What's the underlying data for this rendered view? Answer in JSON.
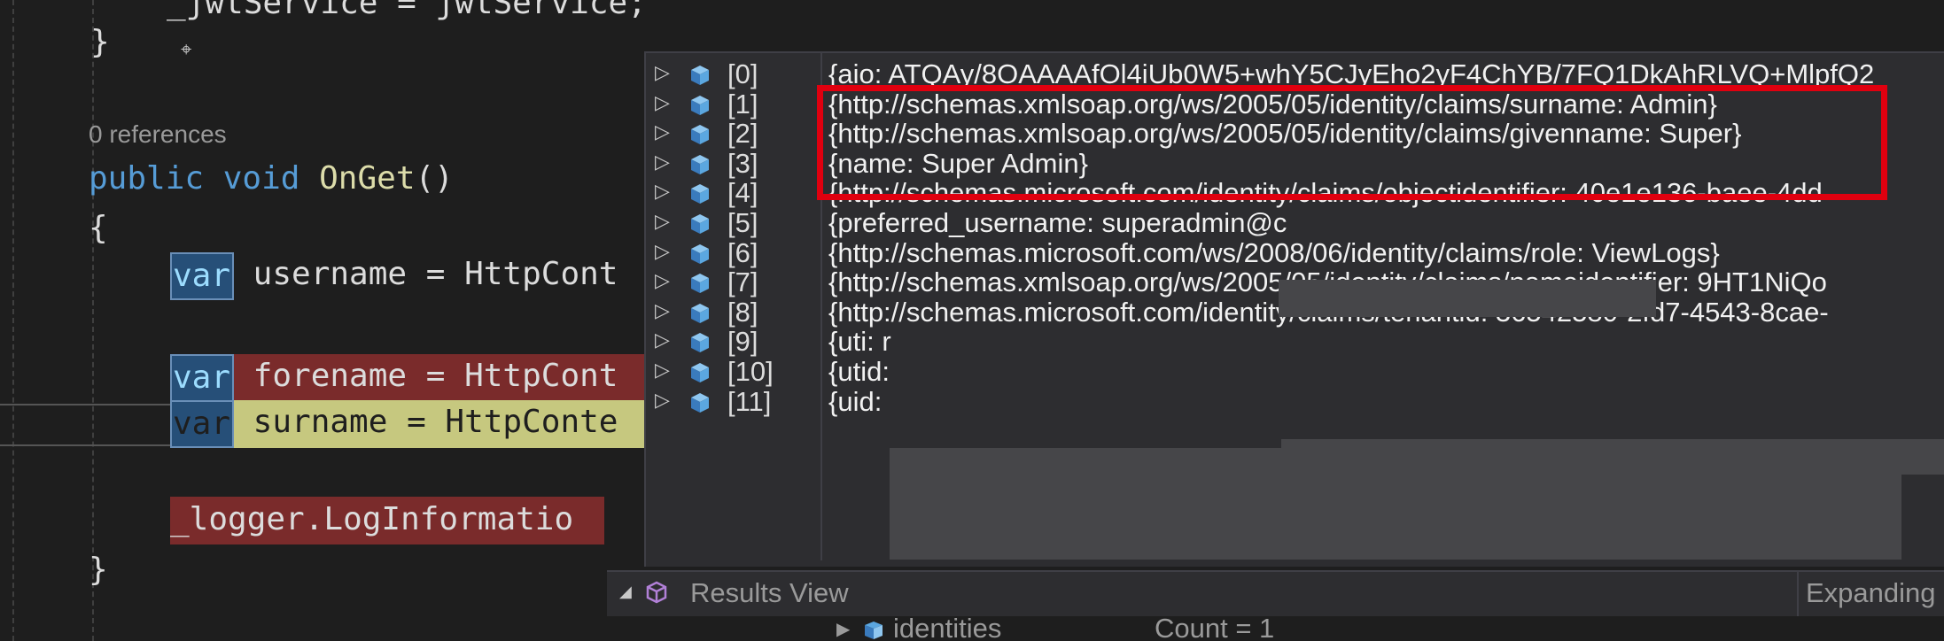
{
  "editor": {
    "line_partial_top": "_jwtService = jwtService;",
    "closing_brace_1": "}",
    "references": "0 references",
    "method_sig": {
      "public": "public",
      "void": "void",
      "name": "OnGet",
      "parens": "()"
    },
    "open_brace": "{",
    "line_username": {
      "var": "var",
      "rest": " username = HttpCont"
    },
    "line_forename": {
      "var": "var",
      "rest": " forename = HttpCont"
    },
    "line_surname": {
      "var": "var",
      "rest": " surname = HttpConte"
    },
    "line_logger": "_logger.LogInformatio",
    "closing_brace_2": "}"
  },
  "datatip": {
    "rows": [
      {
        "index": "[0]",
        "value": "{aio: ATQAy/8OAAAAfOl4iUb0W5+whY5CJyEho2yF4ChYB/7FQ1DkAhRLVQ+MlpfQ2"
      },
      {
        "index": "[1]",
        "value": "{http://schemas.xmlsoap.org/ws/2005/05/identity/claims/surname: Admin}"
      },
      {
        "index": "[2]",
        "value": "{http://schemas.xmlsoap.org/ws/2005/05/identity/claims/givenname: Super}"
      },
      {
        "index": "[3]",
        "value": "{name: Super Admin}"
      },
      {
        "index": "[4]",
        "value": "{http://schemas.microsoft.com/identity/claims/objectidentifier: 40e1e136-baee-4dd"
      },
      {
        "index": "[5]",
        "value": "{preferred_username: superadmin@c"
      },
      {
        "index": "[6]",
        "value": "{http://schemas.microsoft.com/ws/2008/06/identity/claims/role: ViewLogs}"
      },
      {
        "index": "[7]",
        "value": "{http://schemas.xmlsoap.org/ws/2005/05/identity/claims/nameidentifier: 9HT1NiQo"
      },
      {
        "index": "[8]",
        "value": "{http://schemas.microsoft.com/identity/claims/tenantid: 36542580-2fd7-4543-8cae-"
      },
      {
        "index": "[9]",
        "value": "{uti: r"
      },
      {
        "index": "[10]",
        "value": "{utid:"
      },
      {
        "index": "[11]",
        "value": "{uid:"
      }
    ],
    "results_view": "Results View",
    "expanding": "Expanding",
    "identities": "identities",
    "count": "Count = 1"
  },
  "colors": {
    "highlight_box": "#e0000f",
    "cube_icon": "#5ba7e0",
    "results_icon": "#b180d7"
  }
}
